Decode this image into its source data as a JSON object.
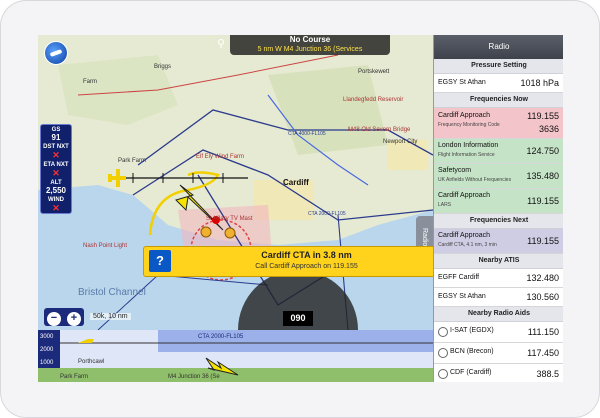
{
  "course": {
    "title": "No Course",
    "subtitle": "5 nm W M4 Junction 36 (Services"
  },
  "instruments": [
    {
      "label": "GS",
      "value": "91"
    },
    {
      "label": "DST NXT",
      "value": "✕"
    },
    {
      "label": "ETA NXT",
      "value": "✕"
    },
    {
      "label": "ALT",
      "value": "2,550"
    },
    {
      "label": "WIND",
      "value": "✕"
    }
  ],
  "map_labels": {
    "briggs": "Briggs",
    "farm": "Farm",
    "portskewett": "Portskewett",
    "llandegfedd": "Llandegfedd Reservoir",
    "m48": "M48 Old Severn Bridge",
    "newport": "Newport City",
    "cardiff": "Cardiff",
    "park_farm": "Park Farm",
    "elywind": "Elf Ely Wind Farm",
    "sthilary": "St Hilary TV Mast",
    "nash": "Nash Point Light",
    "bristol": "Bristol Channel",
    "cta1": "CTA 4000-FL105",
    "cta2": "CTA 2000-FL105",
    "cta_profile": "CTA 2000-FL105",
    "porthcawl": "Porthcawl",
    "parkfarm2": "Park Farm",
    "m4": "M4 Junction 36 (Se"
  },
  "alert": {
    "title": "Cardiff CTA in 3.8 nm",
    "subtitle": "Call Cardiff Approach on 119.155",
    "icon": "?"
  },
  "scale": "50k, 10 nm",
  "heading": "090",
  "profile_alts": [
    "3000",
    "2000",
    "1000"
  ],
  "radio_tab": "Radio",
  "panel": {
    "title": "Radio",
    "pressure_header": "Pressure Setting",
    "pressure": {
      "name": "EGSY St Athan",
      "value": "1018 hPa"
    },
    "freq_now_header": "Frequencies Now",
    "freq_now": [
      {
        "name": "Cardiff Approach",
        "sub": "Frequency Monitoring Code",
        "freq": "119.155",
        "code": "3636",
        "color": "pink"
      },
      {
        "name": "London Information",
        "sub": "Flight Information Service",
        "freq": "124.750",
        "color": "green"
      },
      {
        "name": "Safetycom",
        "sub": "UK Airfields Without Frequencies",
        "freq": "135.480",
        "color": "green"
      },
      {
        "name": "Cardiff Approach",
        "sub": "LARS",
        "freq": "119.155",
        "color": "green"
      }
    ],
    "freq_next_header": "Frequencies Next",
    "freq_next": {
      "name": "Cardiff Approach",
      "sub": "Cardiff CTA, 4.1 nm, 3 min",
      "freq": "119.155"
    },
    "atis_header": "Nearby ATIS",
    "atis": [
      {
        "name": "EGFF Cardiff",
        "freq": "132.480"
      },
      {
        "name": "EGSY St Athan",
        "freq": "130.560"
      }
    ],
    "aids_header": "Nearby Radio Aids",
    "aids": [
      {
        "name": "I-SAT (EGDX)",
        "freq": "111.150"
      },
      {
        "name": "BCN (Brecon)",
        "freq": "117.450"
      },
      {
        "name": "CDF (Cardiff)",
        "freq": "388.5"
      }
    ]
  }
}
